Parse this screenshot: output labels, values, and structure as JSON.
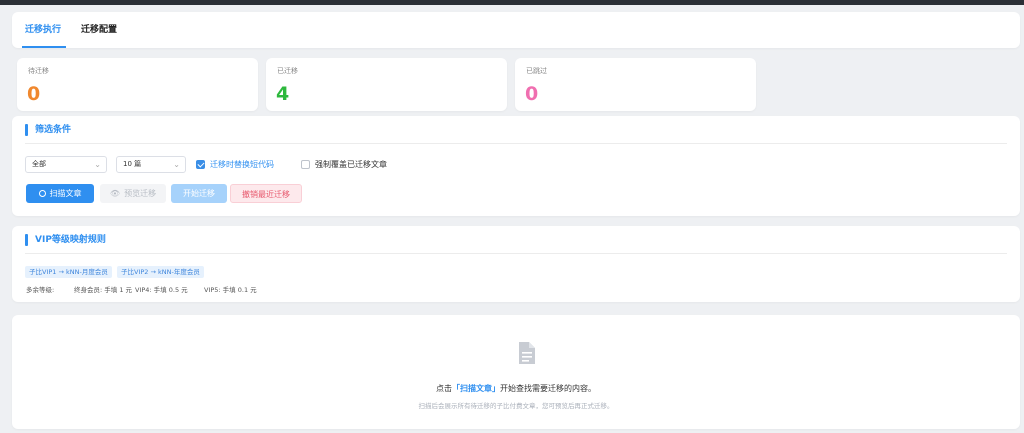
{
  "tabs": [
    {
      "label": "迁移执行",
      "active": true
    },
    {
      "label": "迁移配置",
      "active": false
    }
  ],
  "stats": [
    {
      "label": "待迁移",
      "value": "0",
      "color": "#f0882e"
    },
    {
      "label": "已迁移",
      "value": "4",
      "color": "#2db83d"
    },
    {
      "label": "已跳过",
      "value": "0",
      "color": "#f06fb0"
    }
  ],
  "filters": {
    "title": "筛选条件",
    "scope_select": "全部",
    "count_select": "10 篇",
    "replace_shortcode": {
      "label": "迁移时替换短代码",
      "checked": true
    },
    "force_overwrite": {
      "label": "强制覆盖已迁移文章",
      "checked": false
    },
    "buttons": {
      "scan": "扫描文章",
      "preview": "预览迁移",
      "start": "开始迁移",
      "undo": "撤销最近迁移"
    }
  },
  "vip": {
    "title": "VIP等级映射规则",
    "tags": [
      "子比VIP1 → kNN-月度会员",
      "子比VIP2 → kNN-年度会员"
    ],
    "extra_label": "多余等级:",
    "extra_items": [
      "终身会员: 手填 1 元",
      "VIP4: 手填 0.5 元",
      "VIP5: 手填 0.1 元"
    ]
  },
  "empty": {
    "prefix": "点击",
    "highlight": "「扫描文章」",
    "suffix": "开始查找需要迁移的内容。",
    "sub": "扫描后会展示所有待迁移的子比付费文章，您可预览后再正式迁移。"
  },
  "colors": {
    "accent": "#2f8ff0"
  }
}
